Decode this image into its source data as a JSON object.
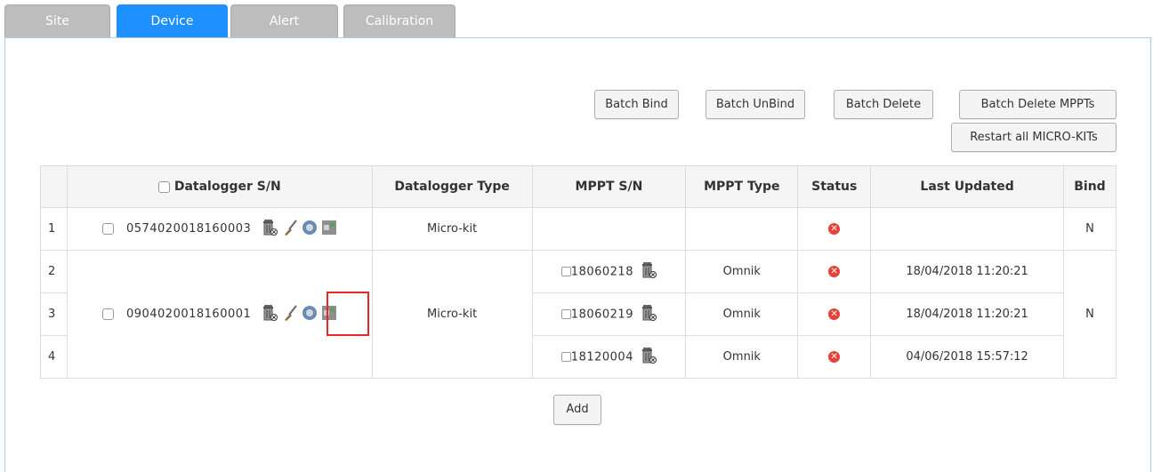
{
  "tabs": [
    {
      "label": "Site",
      "active": false
    },
    {
      "label": "Device",
      "active": true
    },
    {
      "label": "Alert",
      "active": false
    },
    {
      "label": "Calibration",
      "active": false
    }
  ],
  "toolbar": {
    "batch_bind": "Batch Bind",
    "batch_unbind": "Batch UnBind",
    "batch_delete": "Batch Delete",
    "batch_delete_mppts": "Batch Delete MPPTs",
    "restart_all": "Restart all MICRO-KITs"
  },
  "table": {
    "headers": {
      "datalogger_sn": "Datalogger S/N",
      "datalogger_type": "Datalogger Type",
      "mppt_sn": "MPPT S/N",
      "mppt_type": "MPPT Type",
      "status": "Status",
      "last_updated": "Last Updated",
      "bind": "Bind"
    },
    "rows": [
      {
        "index": "1",
        "datalogger_sn": "0574020018160003",
        "datalogger_type": "Micro-kit",
        "mppt_sn": "",
        "mppt_type": "",
        "last_updated": "",
        "bind": "N"
      },
      {
        "index": "2",
        "mppt_sn": "18060218",
        "mppt_type": "Omnik",
        "last_updated": "18/04/2018 11:20:21"
      },
      {
        "index": "3",
        "datalogger_sn": "0904020018160001",
        "datalogger_type": "Micro-kit",
        "mppt_sn": "18060219",
        "mppt_type": "Omnik",
        "last_updated": "18/04/2018 11:20:21",
        "bind": "N"
      },
      {
        "index": "4",
        "mppt_sn": "18120004",
        "mppt_type": "Omnik",
        "last_updated": "04/06/2018 15:57:12"
      }
    ]
  },
  "add_button": "Add",
  "colors": {
    "tab_active": "#1e90ff",
    "tab_inactive": "#bdbdbd",
    "status_error": "#e8413a",
    "highlight": "#e8262a"
  }
}
